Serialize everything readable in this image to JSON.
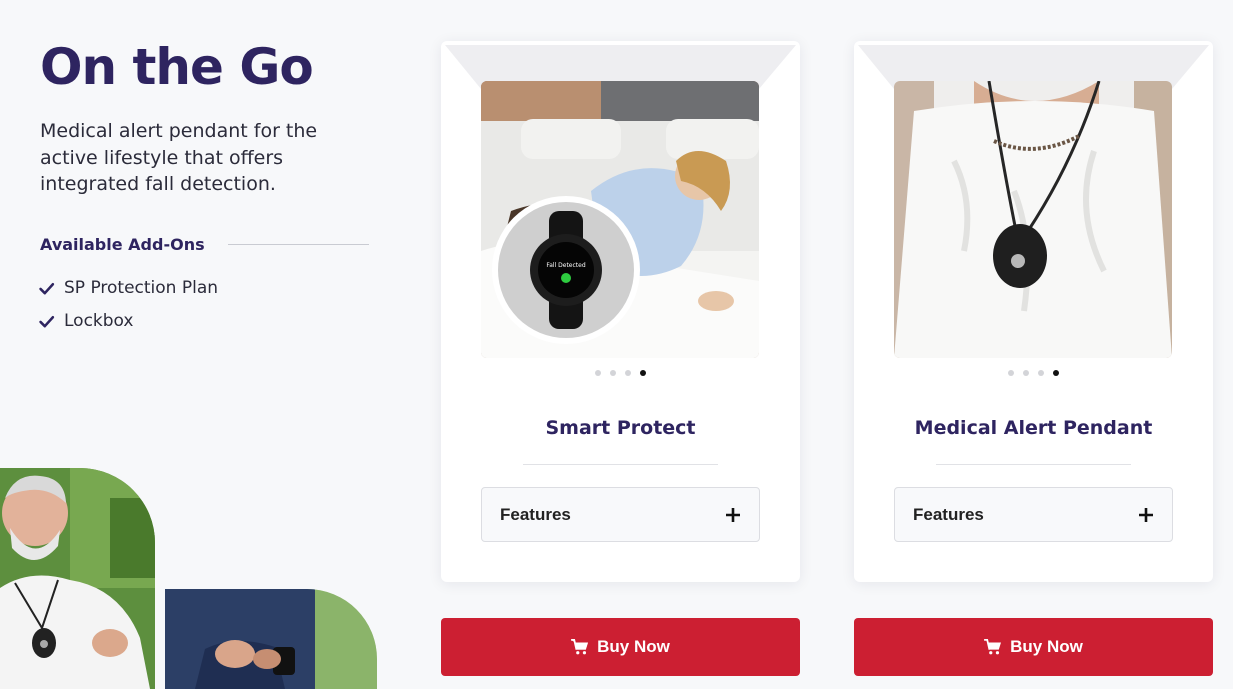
{
  "hero": {
    "title": "On the Go",
    "description": "Medical alert pendant for the active lifestyle that offers integrated fall detection."
  },
  "addons": {
    "title": "Available Add-Ons",
    "items": [
      "SP Protection Plan",
      "Lockbox"
    ]
  },
  "products": [
    {
      "name": "Smart Protect",
      "features_label": "Features",
      "buy_label": "Buy Now",
      "slides_total": 4,
      "active_slide": 4,
      "watch_screen_text": "Fall Detected"
    },
    {
      "name": "Medical Alert Pendant",
      "features_label": "Features",
      "buy_label": "Buy Now",
      "slides_total": 4,
      "active_slide": 4
    }
  ],
  "colors": {
    "brand_purple": "#2e2460",
    "buy_red": "#cc1f32",
    "background": "#f7f8fa"
  },
  "icons": [
    "check-icon",
    "plus-icon",
    "cart-icon"
  ]
}
